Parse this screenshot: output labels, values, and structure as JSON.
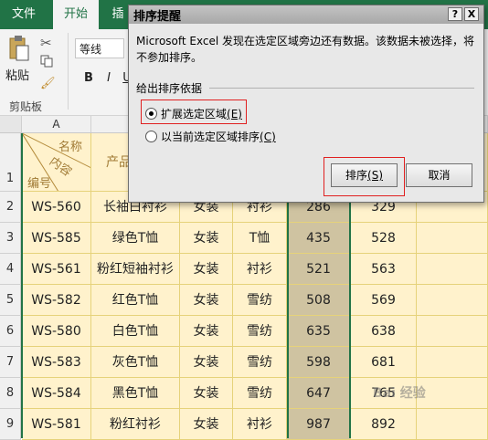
{
  "ribbon": {
    "tabs": [
      "文件",
      "开始",
      "插"
    ],
    "paste_label": "粘贴",
    "clipboard_label": "剪贴板",
    "font_name": "等线",
    "bold": "B",
    "italic": "I",
    "underline": "U"
  },
  "columns": {
    "A": "A"
  },
  "row_numbers": [
    "1",
    "2",
    "3",
    "4",
    "5",
    "6",
    "7",
    "8",
    "9"
  ],
  "header": {
    "diag_top": "名称",
    "diag_mid": "内容",
    "diag_bottom": "编号",
    "product": "产品"
  },
  "rows": [
    [
      "WS-560",
      "长袖白衬衫",
      "女装",
      "衬衫",
      "286",
      "329"
    ],
    [
      "WS-585",
      "绿色T恤",
      "女装",
      "T恤",
      "435",
      "528"
    ],
    [
      "WS-561",
      "粉红短袖衬衫",
      "女装",
      "衬衫",
      "521",
      "563"
    ],
    [
      "WS-582",
      "红色T恤",
      "女装",
      "雪纺",
      "508",
      "569"
    ],
    [
      "WS-580",
      "白色T恤",
      "女装",
      "雪纺",
      "635",
      "638"
    ],
    [
      "WS-583",
      "灰色T恤",
      "女装",
      "雪纺",
      "598",
      "681"
    ],
    [
      "WS-584",
      "黑色T恤",
      "女装",
      "雪纺",
      "647",
      "765"
    ],
    [
      "WS-581",
      "粉红衬衫",
      "女装",
      "衬衫",
      "987",
      "892"
    ]
  ],
  "dialog": {
    "title": "排序提醒",
    "help_btn": "?",
    "close_btn": "X",
    "message": "Microsoft Excel 发现在选定区域旁边还有数据。该数据未被选择，将不参加排序。",
    "group_label": "给出排序依据",
    "option_expand": "扩展选定区域",
    "option_expand_key": "(E)",
    "option_current": "以当前选定区域排序",
    "option_current_key": "(C)",
    "sort_btn": "排序",
    "sort_btn_key": "(S)",
    "cancel_btn": "取消"
  },
  "watermark": "Bai 经验",
  "colors": {
    "excel_green": "#217346",
    "cell_fill": "#fff2cc",
    "selected_fill": "#cfc3a1",
    "highlight_red": "#e02020"
  }
}
